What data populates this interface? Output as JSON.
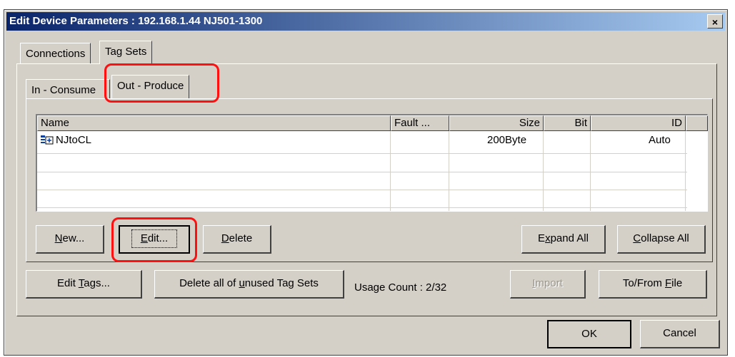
{
  "window": {
    "title": "Edit Device Parameters : 192.168.1.44 NJ501-1300",
    "close_glyph": "×"
  },
  "outer_tabs": [
    {
      "label": "Connections"
    },
    {
      "label": "Tag Sets"
    }
  ],
  "inner_tabs": [
    {
      "label": "In - Consume"
    },
    {
      "label": "Out - Produce"
    }
  ],
  "table": {
    "columns": [
      "Name",
      "Fault ...",
      "Size",
      "Bit",
      "ID"
    ],
    "rows": [
      {
        "name": "NJtoCL",
        "fault": "",
        "size": "200Byte",
        "bit": "",
        "id": "Auto",
        "icon": "tagset-icon"
      }
    ]
  },
  "list_buttons": {
    "new": {
      "pre": "",
      "ul": "N",
      "post": "ew..."
    },
    "edit": {
      "pre": "",
      "ul": "E",
      "post": "dit..."
    },
    "delete": {
      "pre": "",
      "ul": "D",
      "post": "elete"
    },
    "expand_all": {
      "pre": "E",
      "ul": "x",
      "post": "pand All"
    },
    "collapse_all": {
      "pre": "",
      "ul": "C",
      "post": "ollapse All"
    }
  },
  "bottom_buttons": {
    "edit_tags": {
      "pre": "Edit ",
      "ul": "T",
      "post": "ags..."
    },
    "delete_unused": {
      "pre": "Delete all of ",
      "ul": "u",
      "post": "nused Tag Sets"
    },
    "import": {
      "pre": "",
      "ul": "I",
      "post": "mport"
    },
    "to_from_file": {
      "pre": "To/From ",
      "ul": "F",
      "post": "ile"
    }
  },
  "usage_count": "Usage Count :  2/32",
  "dialog_buttons": {
    "ok": "OK",
    "cancel": "Cancel"
  },
  "colors": {
    "title_start": "#0a246a",
    "title_end": "#a6caf0",
    "face": "#d4d0c8",
    "highlight_ring": "#ff1010"
  }
}
